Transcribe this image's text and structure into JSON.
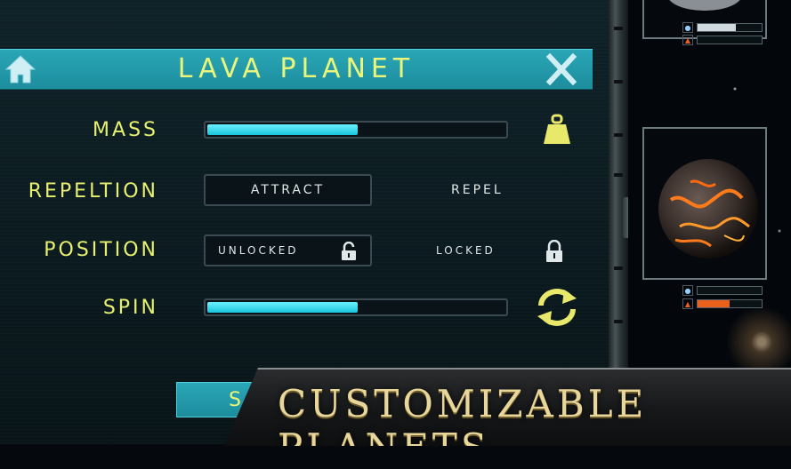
{
  "panel": {
    "title": "LAVA PLANET",
    "rows": {
      "mass": {
        "label": "MASS",
        "value": 0.5
      },
      "repeltion": {
        "label": "REPELTION",
        "option_a": "ATTRACT",
        "option_b": "REPEL"
      },
      "position": {
        "label": "POSITION",
        "option_a": "UNLOCKED",
        "option_b": "LOCKED"
      },
      "spin": {
        "label": "SPIN",
        "value": 0.5
      }
    },
    "save_partial": "S"
  },
  "cards": {
    "top": {
      "water_level": 0.6,
      "heat_level": 0.0
    },
    "lava": {
      "water_level": 0.0,
      "heat_level": 0.5
    }
  },
  "banner": {
    "text": "CUSTOMIZABLE PLANETS"
  },
  "colors": {
    "accent": "#1c8d9d",
    "title": "#eaf57a",
    "slider_fill": "#19c5dc",
    "heat": "#e8601c"
  }
}
